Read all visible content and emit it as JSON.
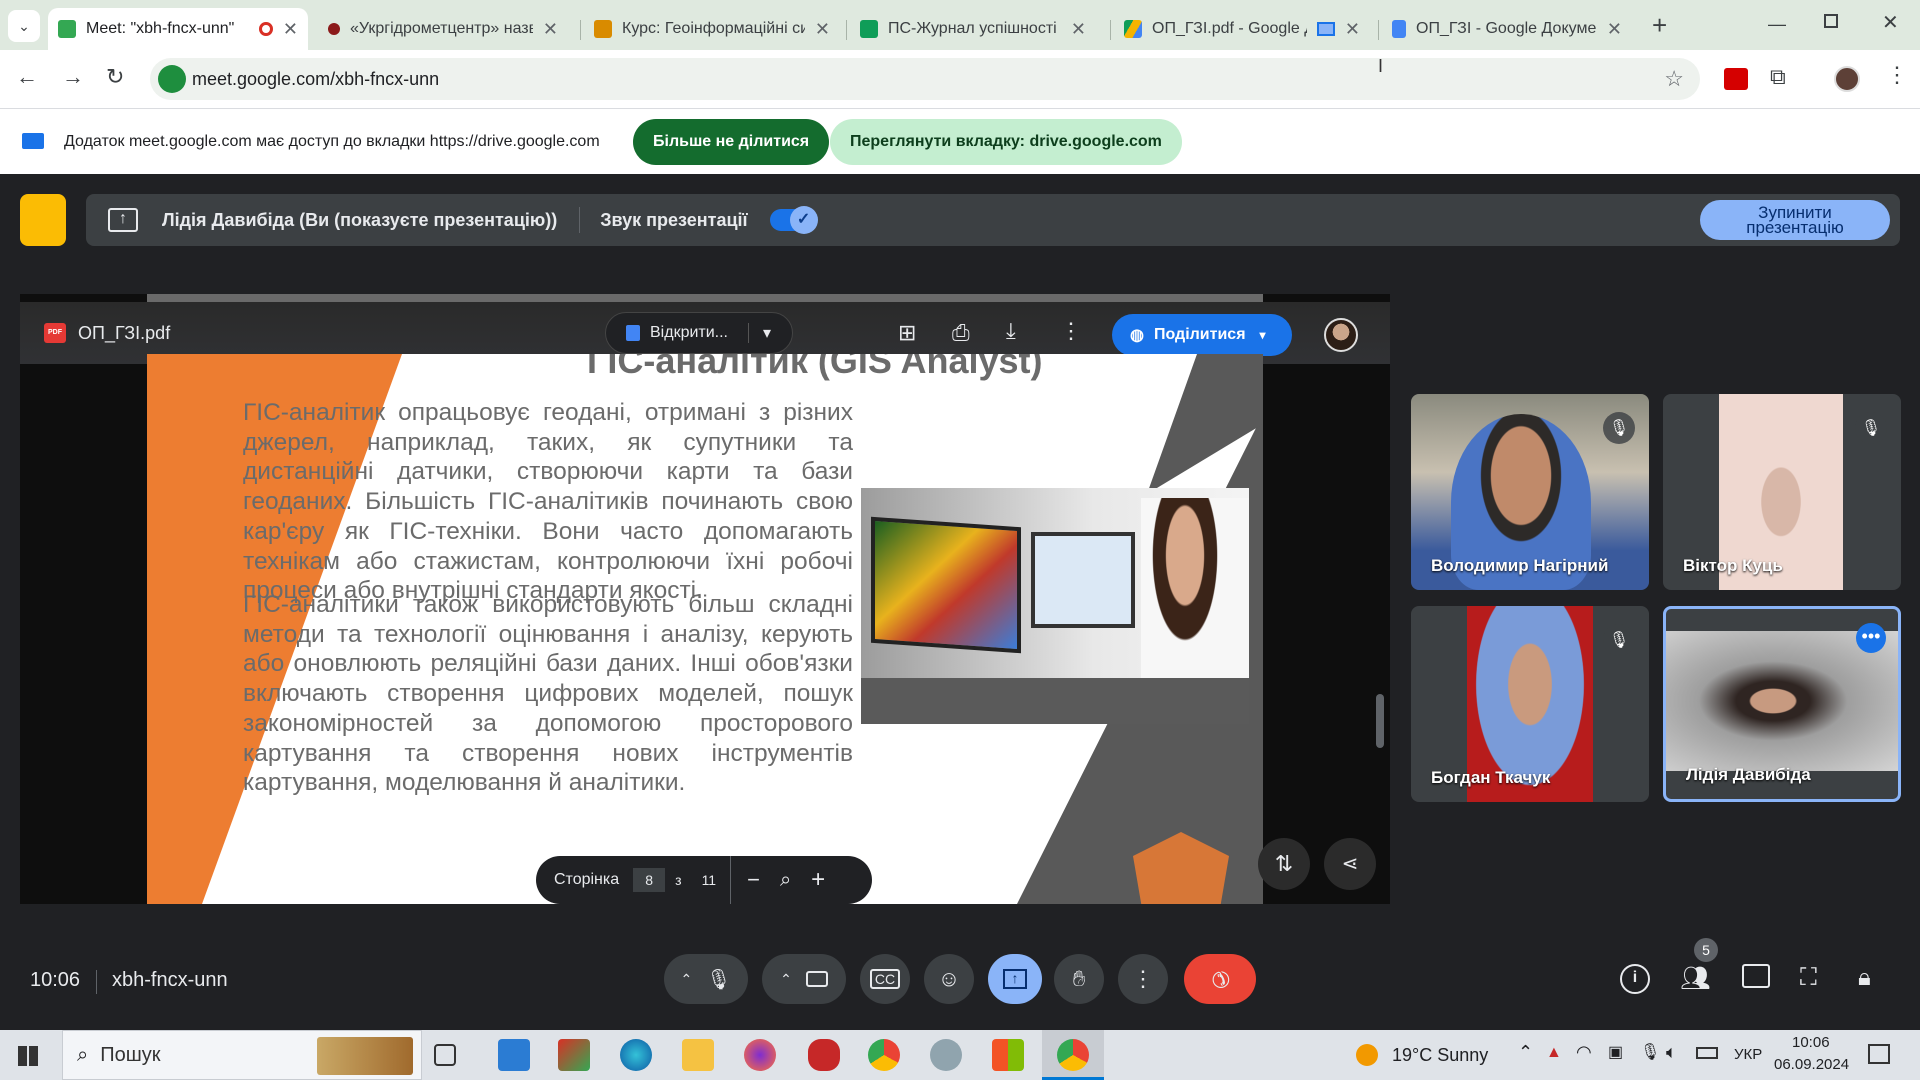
{
  "browser": {
    "tabs": [
      {
        "title": "Meet: \"xbh-fncx-unn\"",
        "color": "#34a853",
        "active": true
      },
      {
        "title": "«Укргідрометцентр» назв",
        "color": "#8b1a1a"
      },
      {
        "title": "Курс: Геоінформаційні си",
        "color": "#d98b00"
      },
      {
        "title": "ПС-Журнал успішності W",
        "color": "#0f9d58"
      },
      {
        "title": "ОП_ГЗІ.pdf - Google Д",
        "color": "#4285f4"
      },
      {
        "title": "ОП_ГЗІ - Google Докумен",
        "color": "#4285f4"
      }
    ],
    "new_tab": "+",
    "url": "meet.google.com/xbh-fncx-unn",
    "infobar_text": "Додаток meet.google.com має доступ до вкладки https://drive.google.com",
    "stop_sharing_btn": "Більше не ділитися",
    "view_tab_btn": "Переглянути вкладку: drive.google.com"
  },
  "meet": {
    "presenter_text": "Лідія Давибіда (Ви (показуєте презентацію))",
    "audio_label": "Звук презентації",
    "audio_on": true,
    "stop_presenting": "Зупинити презентацію",
    "pdf": {
      "filename": "ОП_ГЗІ.pdf",
      "open_with": "Відкрити...",
      "share": "Поділитися",
      "page_label": "Сторінка",
      "page": "8",
      "of": "з",
      "total": "11"
    },
    "slide": {
      "title": "ГІС-аналітик (GIS Analyst)",
      "para1": "ГІС-аналітик опрацьовує  геодані, отримані з різних джерел, наприклад, таких, як супутники та дистанційні датчики, створюючи карти та бази геоданих. Більшість ГІС-аналітиків починають свою кар'єру як ГІС-техніки. Вони часто допомагають технікам або стажистам, контролюючи їхні робочі процеси або внутрішні стандарти якості.",
      "para2": "ГІС-аналітики також використовують більш складні методи та технології оцінювання і аналізу, керують або оновлюють реляційні бази даних. Інші обов'язки включають створення цифрових моделей, пошук закономірностей за допомогою просторового картування та створення нових інструментів картування, моделювання й аналітики."
    },
    "participants": [
      {
        "name": "Володимир Нагірний"
      },
      {
        "name": "Віктор Куць"
      },
      {
        "name": "Богдан Ткачук"
      },
      {
        "name": "Лідія Давибіда"
      }
    ],
    "time": "10:06",
    "meeting_code": "xbh-fncx-unn",
    "people_count": "5",
    "colors": {
      "end_call": "#ea4335",
      "present_active": "#8ab4f8",
      "accent": "#1a73e8"
    }
  },
  "taskbar": {
    "search": "Пошук",
    "weather": "19°C  Sunny",
    "lang": "УКР",
    "time": "10:06",
    "date": "06.09.2024"
  }
}
